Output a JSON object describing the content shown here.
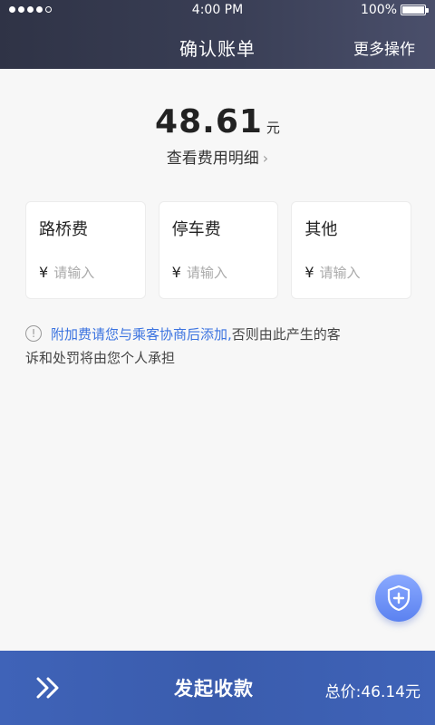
{
  "status_bar": {
    "time": "4:00 PM",
    "battery": "100%"
  },
  "nav": {
    "title": "确认账单",
    "more": "更多操作"
  },
  "fare": {
    "amount": "48.61",
    "unit": "元",
    "detail_link": "查看费用明细",
    "chevron": "›"
  },
  "fees": [
    {
      "title": "路桥费",
      "currency": "¥",
      "placeholder": "请输入"
    },
    {
      "title": "停车费",
      "currency": "¥",
      "placeholder": "请输入"
    },
    {
      "title": "其他",
      "currency": "¥",
      "placeholder": "请输入"
    }
  ],
  "notice": {
    "icon": "!",
    "highlight": "附加费请您与乘客协商后添加,",
    "text_line1": "否则由此产生的客",
    "text_line2": "诉和处罚将由您个人承担"
  },
  "bottom": {
    "action": "发起收款",
    "total": "总价:46.14元"
  },
  "colors": {
    "header": "#3a3f56",
    "accent": "#3b73e0",
    "bottom_bar": "#3a5cad",
    "fab": "#5b82f0"
  }
}
